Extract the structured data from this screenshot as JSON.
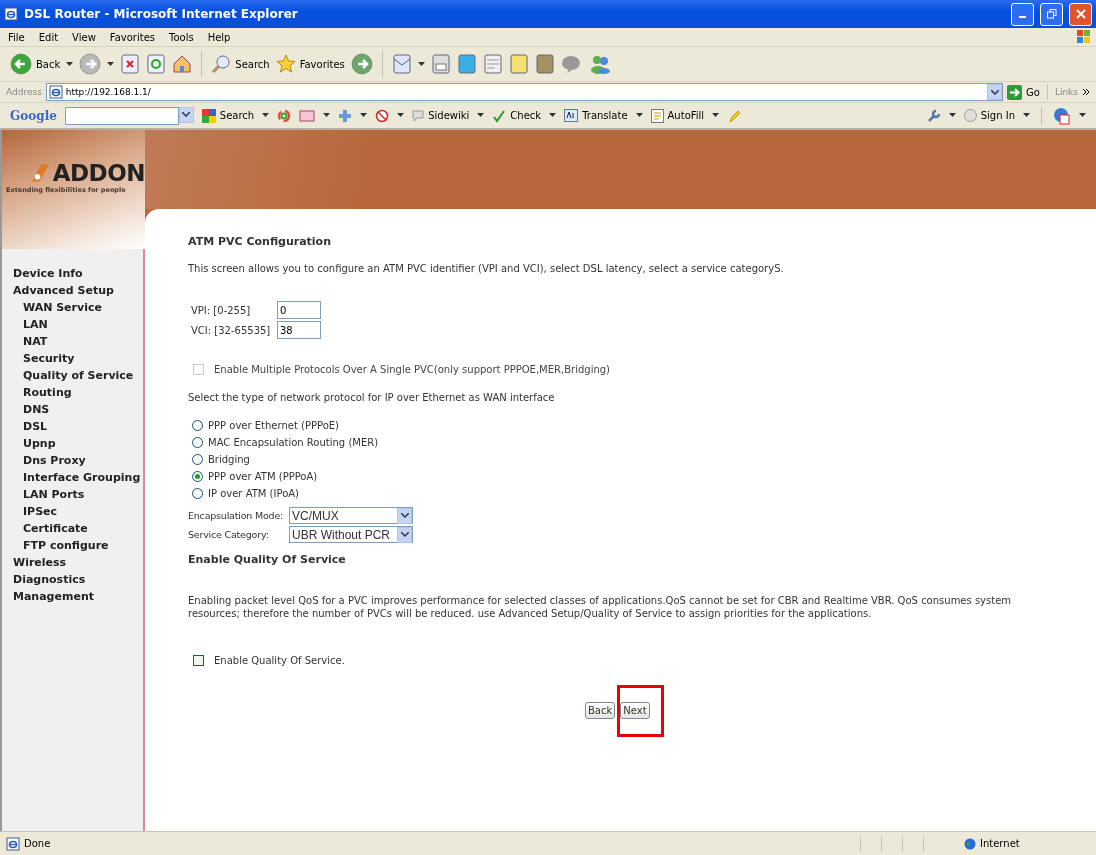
{
  "window": {
    "title": "DSL Router - Microsoft Internet Explorer"
  },
  "menu": [
    "File",
    "Edit",
    "View",
    "Favorites",
    "Tools",
    "Help"
  ],
  "toolbar": {
    "back": "Back",
    "search": "Search",
    "favorites": "Favorites"
  },
  "address": {
    "label": "Address",
    "url": "http://192.168.1.1/",
    "go": "Go",
    "links": "Links"
  },
  "google_bar": {
    "logo": "Google",
    "items": [
      {
        "kind": "search",
        "label": "Search"
      },
      {
        "kind": "sidewiki",
        "label": "Sidewiki"
      },
      {
        "kind": "check",
        "label": "Check"
      },
      {
        "kind": "translate",
        "label": "Translate"
      },
      {
        "kind": "autofill",
        "label": "AutoFill"
      }
    ],
    "sign_in": "Sign In"
  },
  "brand": {
    "name": "ADDON",
    "tagline": "Extending flexibilities for people"
  },
  "sidebar": {
    "items": [
      {
        "label": "Device Info"
      },
      {
        "label": "Advanced Setup",
        "children": [
          {
            "label": "WAN Service"
          },
          {
            "label": "LAN"
          },
          {
            "label": "NAT"
          },
          {
            "label": "Security"
          },
          {
            "label": "Quality of Service"
          },
          {
            "label": "Routing"
          },
          {
            "label": "DNS"
          },
          {
            "label": "DSL"
          },
          {
            "label": "Upnp"
          },
          {
            "label": "Dns Proxy"
          },
          {
            "label": "Interface Grouping"
          },
          {
            "label": "LAN Ports"
          },
          {
            "label": "IPSec"
          },
          {
            "label": "Certificate"
          },
          {
            "label": "FTP configure"
          }
        ]
      },
      {
        "label": "Wireless"
      },
      {
        "label": "Diagnostics"
      },
      {
        "label": "Management"
      }
    ]
  },
  "content": {
    "title": "ATM PVC Configuration",
    "intro": "This screen allows you to configure an ATM PVC identifier (VPI and VCI), select DSL latency, select a service categoryS.",
    "fields": [
      {
        "label": "VPI: [0-255]",
        "value": "0"
      },
      {
        "label": "VCI: [32-65535]",
        "value": "38"
      }
    ],
    "multi_protocol": {
      "label": "Enable Multiple Protocols Over A Single PVC(only support PPPOE,MER,Bridging)",
      "checked": false,
      "disabled": true
    },
    "protocol_prompt": "Select the type of network protocol for IP over Ethernet as WAN interface",
    "protocols": [
      {
        "label": "PPP over Ethernet (PPPoE)",
        "selected": false
      },
      {
        "label": "MAC Encapsulation Routing (MER)",
        "selected": false
      },
      {
        "label": "Bridging",
        "selected": false
      },
      {
        "label": "PPP over ATM (PPPoA)",
        "selected": true
      },
      {
        "label": "IP over ATM (IPoA)",
        "selected": false
      }
    ],
    "selects": [
      {
        "label": "Encapsulation Mode:",
        "value": "VC/MUX"
      },
      {
        "label": "Service Category:",
        "value": "UBR Without PCR"
      }
    ],
    "qos_heading": "Enable Quality Of Service",
    "qos_text": "Enabling packet level QoS for a PVC improves performance for selected classes of applications.QoS cannot be set for CBR and Realtime VBR. QoS consumes system resources; therefore the number of PVCs will be reduced. use Advanced Setup/Quality of Service to assign priorities for the applications.",
    "qos_checkbox": {
      "label": "Enable Quality Of Service.",
      "checked": false
    },
    "buttons": [
      "Back",
      "Next"
    ],
    "annotation": {
      "kind": "frame",
      "color": "#e8000b"
    }
  },
  "status_bar": {
    "status": "Done",
    "zone": "Internet"
  }
}
